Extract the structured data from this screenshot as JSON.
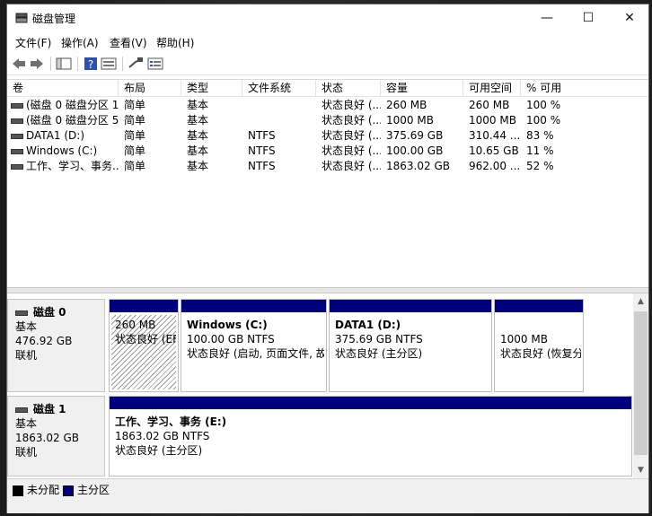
{
  "window": {
    "title": "磁盘管理",
    "minimize": "—",
    "maximize": "☐",
    "close": "✕"
  },
  "menu": [
    "文件(F)",
    "操作(A)",
    "查看(V)",
    "帮助(H)"
  ],
  "toolbar_icons": [
    "back-arrow-icon",
    "forward-arrow-icon",
    "console-tree-icon",
    "help-icon",
    "properties-icon",
    "connect-icon",
    "list-icon"
  ],
  "columns": [
    "卷",
    "布局",
    "类型",
    "文件系统",
    "状态",
    "容量",
    "可用空间",
    "% 可用"
  ],
  "volumes": [
    {
      "name": "(磁盘 0 磁盘分区 1)",
      "layout": "简单",
      "type": "基本",
      "fs": "",
      "status": "状态良好 (...",
      "capacity": "260 MB",
      "free": "260 MB",
      "pct": "100 %"
    },
    {
      "name": "(磁盘 0 磁盘分区 5)",
      "layout": "简单",
      "type": "基本",
      "fs": "",
      "status": "状态良好 (...",
      "capacity": "1000 MB",
      "free": "1000 MB",
      "pct": "100 %"
    },
    {
      "name": "DATA1 (D:)",
      "layout": "简单",
      "type": "基本",
      "fs": "NTFS",
      "status": "状态良好 (...",
      "capacity": "375.69 GB",
      "free": "310.44 ...",
      "pct": "83 %"
    },
    {
      "name": "Windows (C:)",
      "layout": "简单",
      "type": "基本",
      "fs": "NTFS",
      "status": "状态良好 (...",
      "capacity": "100.00 GB",
      "free": "10.65 GB",
      "pct": "11 %"
    },
    {
      "name": "工作、学习、事务...",
      "layout": "简单",
      "type": "基本",
      "fs": "NTFS",
      "status": "状态良好 (...",
      "capacity": "1863.02 GB",
      "free": "962.00 ...",
      "pct": "52 %"
    }
  ],
  "disks": [
    {
      "name": "磁盘 0",
      "type": "基本",
      "size": "476.92 GB",
      "state": "联机",
      "partitions": [
        {
          "name": "",
          "size": "260 MB",
          "status": "状态良好 (EF"
        },
        {
          "name": "Windows  (C:)",
          "size": "100.00 GB NTFS",
          "status": "状态良好 (启动, 页面文件, 故"
        },
        {
          "name": "DATA1  (D:)",
          "size": "375.69 GB NTFS",
          "status": "状态良好 (主分区)"
        },
        {
          "name": "",
          "size": "1000 MB",
          "status": "状态良好 (恢复分"
        }
      ]
    },
    {
      "name": "磁盘 1",
      "type": "基本",
      "size": "1863.02 GB",
      "state": "联机",
      "partitions": [
        {
          "name": "工作、学习、事务  (E:)",
          "size": "1863.02 GB NTFS",
          "status": "状态良好 (主分区)"
        }
      ]
    }
  ],
  "legend": [
    {
      "label": "未分配",
      "color": "#000000"
    },
    {
      "label": "主分区",
      "color": "#00007f"
    }
  ],
  "colors": {
    "partition_bar": "#00007f",
    "selected_hatch": "#9a9a9a"
  }
}
